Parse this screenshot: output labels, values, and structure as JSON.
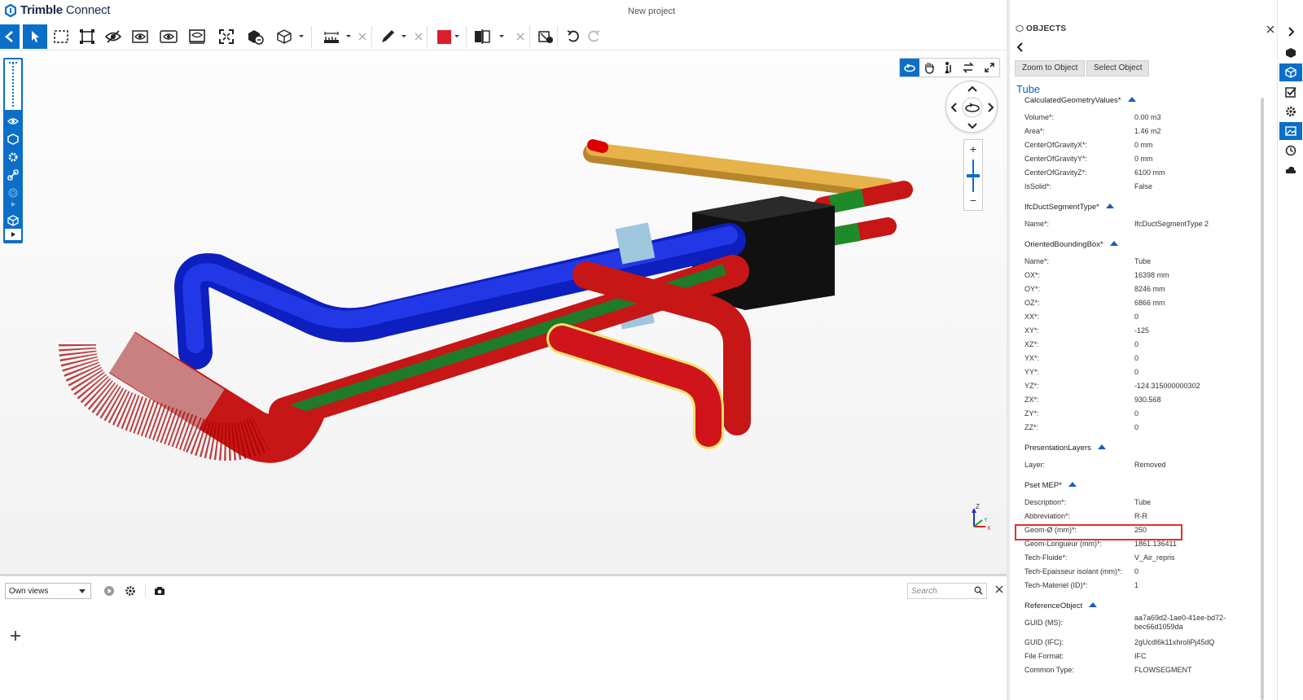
{
  "app": {
    "brand_bold": "Trimble",
    "brand_light": " Connect",
    "project_title": "New project"
  },
  "toolbar": {
    "icons": [
      "back-icon",
      "select-pointer-icon",
      "box-select-icon",
      "fit-selection-icon",
      "hide-eye-icon",
      "show-eye-icon",
      "isolate-icon",
      "section-icon",
      "fit-all-icon",
      "clash-icon",
      "cube-view-icon",
      "measure-icon",
      "clear-measure-icon",
      "markup-pencil-icon",
      "clear-markup-icon",
      "color-fill-icon",
      "section-plane-icon",
      "clear-section-icon",
      "visibility-tool-icon",
      "undo-icon",
      "redo-icon"
    ],
    "color_swatch": "#d9202a"
  },
  "viewport": {
    "nav_modes": [
      "orbit-icon",
      "pan-hand-icon",
      "walk-icon",
      "swap-icon",
      "fullscreen-icon"
    ],
    "zoom_plus": "+",
    "zoom_minus": "−",
    "axes": {
      "z": "Z",
      "y": "Y",
      "x": "X"
    }
  },
  "views": {
    "dropdown_value": "Own views",
    "search_placeholder": "Search",
    "add_label": "+"
  },
  "objects": {
    "title": "OBJECTS",
    "zoom_button": "Zoom to Object",
    "select_button": "Select Object",
    "object_name": "Tube",
    "sections": [
      {
        "name": "CalculatedGeometryValues*",
        "props": [
          {
            "k": "Volume*:",
            "v": "0.00 m3"
          },
          {
            "k": "Area*:",
            "v": "1.46 m2"
          },
          {
            "k": "CenterOfGravityX*:",
            "v": "0 mm"
          },
          {
            "k": "CenterOfGravityY*:",
            "v": "0 mm"
          },
          {
            "k": "CenterOfGravityZ*:",
            "v": "6100 mm"
          },
          {
            "k": "IsSolid*:",
            "v": "False"
          }
        ]
      },
      {
        "name": "IfcDuctSegmentType*",
        "props": [
          {
            "k": "Name*:",
            "v": "IfcDuctSegmentType 2"
          }
        ]
      },
      {
        "name": "OrientedBoundingBox*",
        "props": [
          {
            "k": "Name*:",
            "v": "Tube"
          },
          {
            "k": "OX*:",
            "v": "16398 mm"
          },
          {
            "k": "OY*:",
            "v": "8246 mm"
          },
          {
            "k": "OZ*:",
            "v": "6866 mm"
          },
          {
            "k": "XX*:",
            "v": "0"
          },
          {
            "k": "XY*:",
            "v": "-125"
          },
          {
            "k": "XZ*:",
            "v": "0"
          },
          {
            "k": "YX*:",
            "v": "0"
          },
          {
            "k": "YY*:",
            "v": "0"
          },
          {
            "k": "YZ*:",
            "v": "-124.315000000302"
          },
          {
            "k": "ZX*:",
            "v": "930.568"
          },
          {
            "k": "ZY*:",
            "v": "0"
          },
          {
            "k": "ZZ*:",
            "v": "0"
          }
        ]
      },
      {
        "name": "PresentationLayers",
        "props": [
          {
            "k": "Layer:",
            "v": "Removed"
          }
        ]
      },
      {
        "name": "Pset MEP*",
        "props": [
          {
            "k": "Description*:",
            "v": "Tube"
          },
          {
            "k": "Abbreviation*:",
            "v": "R-R"
          },
          {
            "k": "Geom-Ø (mm)*:",
            "v": "250"
          },
          {
            "k": "Geom-Longueur (mm)*:",
            "v": "1861.136411"
          },
          {
            "k": "Tech-Fluide*:",
            "v": "V_Air_repris"
          },
          {
            "k": "Tech-Epaisseur isolant (mm)*:",
            "v": "0"
          },
          {
            "k": "Tech-Materiel (ID)*:",
            "v": "1"
          }
        ]
      },
      {
        "name": "ReferenceObject",
        "props": [
          {
            "k": "GUID (MS):",
            "v": "aa7a69d2-1ae0-41ee-bd72-bec66d1059da"
          },
          {
            "k": "GUID (IFC):",
            "v": "2gUcdl6k11xhroliPj45dQ"
          },
          {
            "k": "File Format:",
            "v": "IFC"
          },
          {
            "k": "Common Type:",
            "v": "FLOWSEGMENT"
          }
        ]
      }
    ]
  },
  "rail": {
    "icons": [
      "expand-right-icon",
      "model-cube-icon",
      "objects-icon",
      "todo-check-icon",
      "settings-gear-icon",
      "image-view-icon",
      "history-clock-icon",
      "cloud-icon"
    ]
  },
  "colors": {
    "accent": "#0b6fc7",
    "link": "#1a5fb4",
    "highlight": "#e03030"
  }
}
